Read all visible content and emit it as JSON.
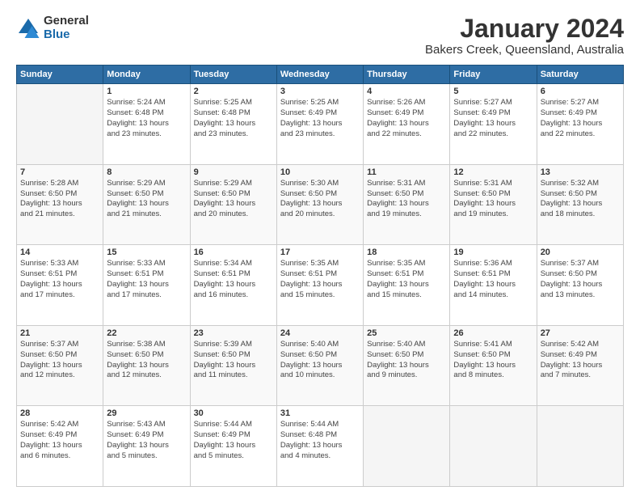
{
  "header": {
    "logo_line1": "General",
    "logo_line2": "Blue",
    "title": "January 2024",
    "subtitle": "Bakers Creek, Queensland, Australia"
  },
  "calendar": {
    "days_of_week": [
      "Sunday",
      "Monday",
      "Tuesday",
      "Wednesday",
      "Thursday",
      "Friday",
      "Saturday"
    ],
    "weeks": [
      [
        {
          "day": "",
          "info": ""
        },
        {
          "day": "1",
          "info": "Sunrise: 5:24 AM\nSunset: 6:48 PM\nDaylight: 13 hours\nand 23 minutes."
        },
        {
          "day": "2",
          "info": "Sunrise: 5:25 AM\nSunset: 6:48 PM\nDaylight: 13 hours\nand 23 minutes."
        },
        {
          "day": "3",
          "info": "Sunrise: 5:25 AM\nSunset: 6:49 PM\nDaylight: 13 hours\nand 23 minutes."
        },
        {
          "day": "4",
          "info": "Sunrise: 5:26 AM\nSunset: 6:49 PM\nDaylight: 13 hours\nand 22 minutes."
        },
        {
          "day": "5",
          "info": "Sunrise: 5:27 AM\nSunset: 6:49 PM\nDaylight: 13 hours\nand 22 minutes."
        },
        {
          "day": "6",
          "info": "Sunrise: 5:27 AM\nSunset: 6:49 PM\nDaylight: 13 hours\nand 22 minutes."
        }
      ],
      [
        {
          "day": "7",
          "info": "Sunrise: 5:28 AM\nSunset: 6:50 PM\nDaylight: 13 hours\nand 21 minutes."
        },
        {
          "day": "8",
          "info": "Sunrise: 5:29 AM\nSunset: 6:50 PM\nDaylight: 13 hours\nand 21 minutes."
        },
        {
          "day": "9",
          "info": "Sunrise: 5:29 AM\nSunset: 6:50 PM\nDaylight: 13 hours\nand 20 minutes."
        },
        {
          "day": "10",
          "info": "Sunrise: 5:30 AM\nSunset: 6:50 PM\nDaylight: 13 hours\nand 20 minutes."
        },
        {
          "day": "11",
          "info": "Sunrise: 5:31 AM\nSunset: 6:50 PM\nDaylight: 13 hours\nand 19 minutes."
        },
        {
          "day": "12",
          "info": "Sunrise: 5:31 AM\nSunset: 6:50 PM\nDaylight: 13 hours\nand 19 minutes."
        },
        {
          "day": "13",
          "info": "Sunrise: 5:32 AM\nSunset: 6:50 PM\nDaylight: 13 hours\nand 18 minutes."
        }
      ],
      [
        {
          "day": "14",
          "info": "Sunrise: 5:33 AM\nSunset: 6:51 PM\nDaylight: 13 hours\nand 17 minutes."
        },
        {
          "day": "15",
          "info": "Sunrise: 5:33 AM\nSunset: 6:51 PM\nDaylight: 13 hours\nand 17 minutes."
        },
        {
          "day": "16",
          "info": "Sunrise: 5:34 AM\nSunset: 6:51 PM\nDaylight: 13 hours\nand 16 minutes."
        },
        {
          "day": "17",
          "info": "Sunrise: 5:35 AM\nSunset: 6:51 PM\nDaylight: 13 hours\nand 15 minutes."
        },
        {
          "day": "18",
          "info": "Sunrise: 5:35 AM\nSunset: 6:51 PM\nDaylight: 13 hours\nand 15 minutes."
        },
        {
          "day": "19",
          "info": "Sunrise: 5:36 AM\nSunset: 6:51 PM\nDaylight: 13 hours\nand 14 minutes."
        },
        {
          "day": "20",
          "info": "Sunrise: 5:37 AM\nSunset: 6:50 PM\nDaylight: 13 hours\nand 13 minutes."
        }
      ],
      [
        {
          "day": "21",
          "info": "Sunrise: 5:37 AM\nSunset: 6:50 PM\nDaylight: 13 hours\nand 12 minutes."
        },
        {
          "day": "22",
          "info": "Sunrise: 5:38 AM\nSunset: 6:50 PM\nDaylight: 13 hours\nand 12 minutes."
        },
        {
          "day": "23",
          "info": "Sunrise: 5:39 AM\nSunset: 6:50 PM\nDaylight: 13 hours\nand 11 minutes."
        },
        {
          "day": "24",
          "info": "Sunrise: 5:40 AM\nSunset: 6:50 PM\nDaylight: 13 hours\nand 10 minutes."
        },
        {
          "day": "25",
          "info": "Sunrise: 5:40 AM\nSunset: 6:50 PM\nDaylight: 13 hours\nand 9 minutes."
        },
        {
          "day": "26",
          "info": "Sunrise: 5:41 AM\nSunset: 6:50 PM\nDaylight: 13 hours\nand 8 minutes."
        },
        {
          "day": "27",
          "info": "Sunrise: 5:42 AM\nSunset: 6:49 PM\nDaylight: 13 hours\nand 7 minutes."
        }
      ],
      [
        {
          "day": "28",
          "info": "Sunrise: 5:42 AM\nSunset: 6:49 PM\nDaylight: 13 hours\nand 6 minutes."
        },
        {
          "day": "29",
          "info": "Sunrise: 5:43 AM\nSunset: 6:49 PM\nDaylight: 13 hours\nand 5 minutes."
        },
        {
          "day": "30",
          "info": "Sunrise: 5:44 AM\nSunset: 6:49 PM\nDaylight: 13 hours\nand 5 minutes."
        },
        {
          "day": "31",
          "info": "Sunrise: 5:44 AM\nSunset: 6:48 PM\nDaylight: 13 hours\nand 4 minutes."
        },
        {
          "day": "",
          "info": ""
        },
        {
          "day": "",
          "info": ""
        },
        {
          "day": "",
          "info": ""
        }
      ]
    ]
  }
}
